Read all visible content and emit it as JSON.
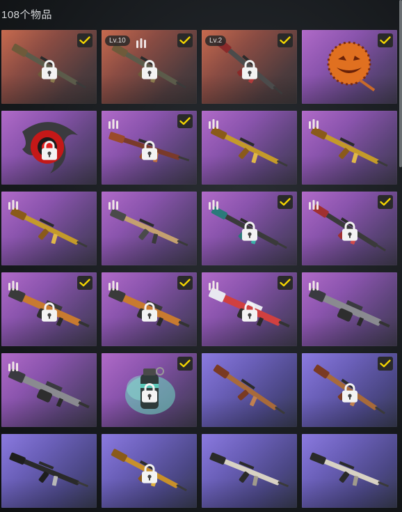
{
  "header": {
    "item_count_label": "108个物品"
  },
  "colors": {
    "check_mark": "#f2d400",
    "check_bg": "#2a2a2a",
    "lock": "#f3f3f3"
  },
  "items": [
    {
      "rarity": "red",
      "art": "rifle-ak",
      "icon": "ak-rifle-icon",
      "locked": true,
      "checked": true,
      "level": "",
      "ammo": false
    },
    {
      "rarity": "red",
      "art": "rifle-ak",
      "icon": "ak-rifle-icon",
      "locked": true,
      "checked": true,
      "level": "Lv.10",
      "ammo": true
    },
    {
      "rarity": "red",
      "art": "rifle-ak-red",
      "icon": "ak-rifle-icon",
      "locked": true,
      "checked": true,
      "level": "Lv.2",
      "ammo": false
    },
    {
      "rarity": "purple",
      "art": "pumpkin",
      "icon": "pumpkin-emblem-icon",
      "locked": false,
      "checked": true,
      "level": "",
      "ammo": false
    },
    {
      "rarity": "purple",
      "art": "emblem",
      "icon": "red-emblem-icon",
      "locked": true,
      "checked": false,
      "level": "",
      "ammo": false
    },
    {
      "rarity": "purple",
      "art": "rifle-sks",
      "icon": "sks-rifle-icon",
      "locked": true,
      "checked": true,
      "level": "",
      "ammo": true
    },
    {
      "rarity": "purple",
      "art": "rifle-gold",
      "icon": "gold-rifle-icon",
      "locked": false,
      "checked": false,
      "level": "",
      "ammo": true
    },
    {
      "rarity": "purple",
      "art": "rifle-gold",
      "icon": "gold-rifle-icon",
      "locked": false,
      "checked": false,
      "level": "",
      "ammo": true
    },
    {
      "rarity": "purple",
      "art": "rifle-gold",
      "icon": "gold-rifle-icon",
      "locked": false,
      "checked": false,
      "level": "",
      "ammo": true
    },
    {
      "rarity": "purple",
      "art": "rifle-m16",
      "icon": "m16-rifle-icon",
      "locked": false,
      "checked": false,
      "level": "",
      "ammo": true
    },
    {
      "rarity": "purple",
      "art": "rifle-teal",
      "icon": "sniper-rifle-icon",
      "locked": true,
      "checked": true,
      "level": "",
      "ammo": true
    },
    {
      "rarity": "purple",
      "art": "rifle-red",
      "icon": "red-rifle-icon",
      "locked": true,
      "checked": true,
      "level": "",
      "ammo": true
    },
    {
      "rarity": "purple",
      "art": "lmg-orange",
      "icon": "lmg-icon",
      "locked": true,
      "checked": true,
      "level": "",
      "ammo": true
    },
    {
      "rarity": "purple",
      "art": "lmg-orange",
      "icon": "lmg-icon",
      "locked": true,
      "checked": true,
      "level": "",
      "ammo": true
    },
    {
      "rarity": "purple",
      "art": "lmg-flag",
      "icon": "lmg-icon",
      "locked": true,
      "checked": true,
      "level": "",
      "ammo": true
    },
    {
      "rarity": "purple",
      "art": "lmg-gray",
      "icon": "lmg-icon",
      "locked": false,
      "checked": false,
      "level": "",
      "ammo": true
    },
    {
      "rarity": "purple",
      "art": "lmg-gray",
      "icon": "lmg-icon",
      "locked": false,
      "checked": false,
      "level": "",
      "ammo": true
    },
    {
      "rarity": "purple",
      "art": "grenade",
      "icon": "smoke-grenade-icon",
      "locked": true,
      "checked": true,
      "level": "",
      "ammo": false
    },
    {
      "rarity": "violet",
      "art": "rifle-wood",
      "icon": "bolt-rifle-icon",
      "locked": false,
      "checked": false,
      "level": "",
      "ammo": false
    },
    {
      "rarity": "violet",
      "art": "rifle-wood",
      "icon": "bolt-rifle-icon",
      "locked": true,
      "checked": true,
      "level": "",
      "ammo": false
    },
    {
      "rarity": "violet",
      "art": "rifle-black",
      "icon": "assault-rifle-icon",
      "locked": false,
      "checked": false,
      "level": "",
      "ammo": false
    },
    {
      "rarity": "violet",
      "art": "smg-gold",
      "icon": "tommy-gun-icon",
      "locked": true,
      "checked": false,
      "level": "",
      "ammo": false
    },
    {
      "rarity": "violet",
      "art": "shotgun",
      "icon": "shotgun-icon",
      "locked": false,
      "checked": false,
      "level": "",
      "ammo": false
    },
    {
      "rarity": "violet",
      "art": "shotgun",
      "icon": "shotgun-icon",
      "locked": false,
      "checked": false,
      "level": "",
      "ammo": false
    }
  ]
}
